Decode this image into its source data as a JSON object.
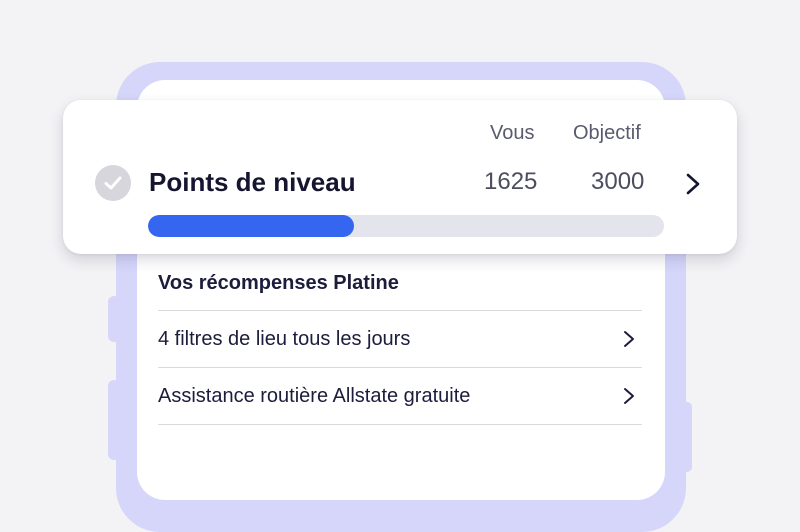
{
  "card": {
    "title": "Points de niveau",
    "col_you": "Vous",
    "col_target": "Objectif",
    "value_you": "1625",
    "value_target": "3000",
    "progress_fraction": 0.4,
    "check_icon": "check-circle-icon",
    "chevron_icon": "chevron-right-icon",
    "accent_color": "#3566f0"
  },
  "rewards": {
    "title": "Vos récompenses Platine",
    "items": [
      {
        "label": "4 filtres de lieu tous les jours"
      },
      {
        "label": "Assistance routière Allstate gratuite"
      }
    ]
  }
}
